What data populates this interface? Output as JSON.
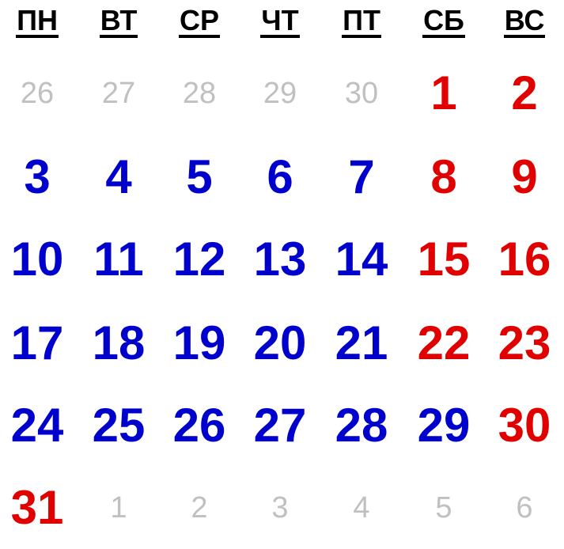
{
  "calendar": {
    "weekdays": [
      "ПН",
      "ВТ",
      "СР",
      "ЧТ",
      "ПТ",
      "СБ",
      "ВС"
    ],
    "colors": {
      "weekday": "#0000cc",
      "weekend": "#e00000",
      "other_month": "#c0c0c0",
      "header": "#000000"
    },
    "weeks": [
      [
        {
          "d": "26",
          "t": "other"
        },
        {
          "d": "27",
          "t": "other"
        },
        {
          "d": "28",
          "t": "other"
        },
        {
          "d": "29",
          "t": "other"
        },
        {
          "d": "30",
          "t": "other"
        },
        {
          "d": "1",
          "t": "weekend"
        },
        {
          "d": "2",
          "t": "weekend"
        }
      ],
      [
        {
          "d": "3",
          "t": "weekday"
        },
        {
          "d": "4",
          "t": "weekday"
        },
        {
          "d": "5",
          "t": "weekday"
        },
        {
          "d": "6",
          "t": "weekday"
        },
        {
          "d": "7",
          "t": "weekday"
        },
        {
          "d": "8",
          "t": "weekend"
        },
        {
          "d": "9",
          "t": "weekend"
        }
      ],
      [
        {
          "d": "10",
          "t": "weekday"
        },
        {
          "d": "11",
          "t": "weekday"
        },
        {
          "d": "12",
          "t": "weekday"
        },
        {
          "d": "13",
          "t": "weekday"
        },
        {
          "d": "14",
          "t": "weekday"
        },
        {
          "d": "15",
          "t": "weekend"
        },
        {
          "d": "16",
          "t": "weekend"
        }
      ],
      [
        {
          "d": "17",
          "t": "weekday"
        },
        {
          "d": "18",
          "t": "weekday"
        },
        {
          "d": "19",
          "t": "weekday"
        },
        {
          "d": "20",
          "t": "weekday"
        },
        {
          "d": "21",
          "t": "weekday"
        },
        {
          "d": "22",
          "t": "weekend"
        },
        {
          "d": "23",
          "t": "weekend"
        }
      ],
      [
        {
          "d": "24",
          "t": "weekday"
        },
        {
          "d": "25",
          "t": "weekday"
        },
        {
          "d": "26",
          "t": "weekday"
        },
        {
          "d": "27",
          "t": "weekday"
        },
        {
          "d": "28",
          "t": "weekday"
        },
        {
          "d": "29",
          "t": "weekday"
        },
        {
          "d": "30",
          "t": "weekend"
        }
      ],
      [
        {
          "d": "31",
          "t": "weekend"
        },
        {
          "d": "1",
          "t": "other"
        },
        {
          "d": "2",
          "t": "other"
        },
        {
          "d": "3",
          "t": "other"
        },
        {
          "d": "4",
          "t": "other"
        },
        {
          "d": "5",
          "t": "other"
        },
        {
          "d": "6",
          "t": "other"
        }
      ]
    ]
  }
}
